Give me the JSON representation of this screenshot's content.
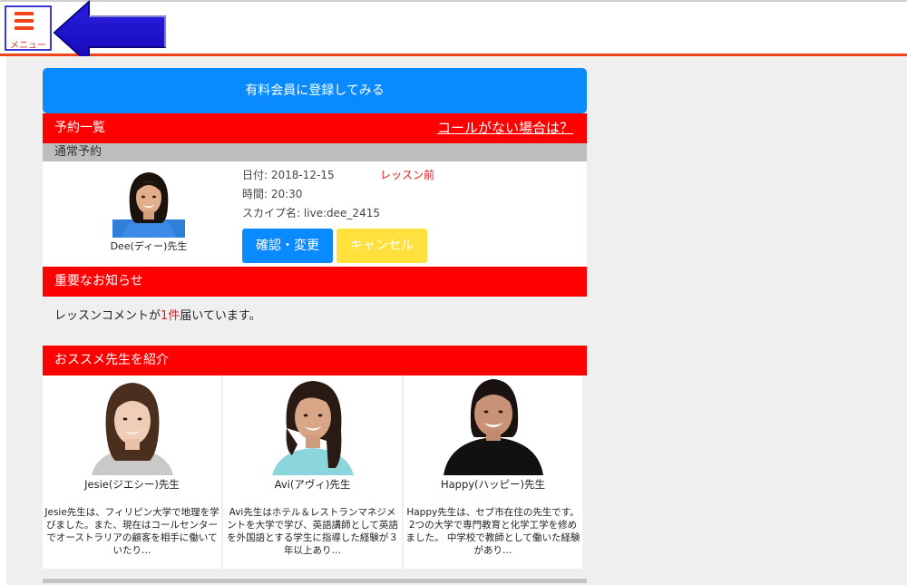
{
  "header": {
    "menu_label": "メニュー"
  },
  "cta": {
    "label": "有料会員に登録してみる"
  },
  "reservations": {
    "title": "予約一覧",
    "help_link": "コールがない場合は？",
    "section": "通常予約",
    "teacher_name": "Dee(ディー)先生",
    "date": "日付: 2018-12-15",
    "time": "時間: 20:30",
    "skype": "スカイプ名: live:dee_2415",
    "status": "レッスン前",
    "confirm_label": "確認・変更",
    "cancel_label": "キャンセル"
  },
  "notices": {
    "title": "重要なお知らせ",
    "text_before": "レッスンコメントが",
    "count": "1件",
    "text_after": "届いています。"
  },
  "recommend": {
    "title": "おススメ先生を紹介",
    "teachers": [
      {
        "name": "Jesie(ジエシー)先生",
        "desc": "Jesie先生は、フィリピン大学で地理を学びました。また、現在はコールセンターでオーストラリアの顧客を相手に働いていたり…"
      },
      {
        "name": "Avi(アヴィ)先生",
        "desc": "Avi先生はホテル＆レストランマネジメントを大学で学び、英語講師として英語を外国語とする学生に指導した経験が３年以上あり…"
      },
      {
        "name": "Happy(ハッピー)先生",
        "desc": "Happy先生は、セブ市在住の先生です。2つの大学で専門教育と化学工学を修めました。 中学校で教師として働いた経験があり…"
      }
    ]
  },
  "colors": {
    "accent_red": "#ff0000",
    "cta_blue": "#0a8aff",
    "cancel_yellow": "#ffe03c",
    "header_line": "#f0451c"
  }
}
